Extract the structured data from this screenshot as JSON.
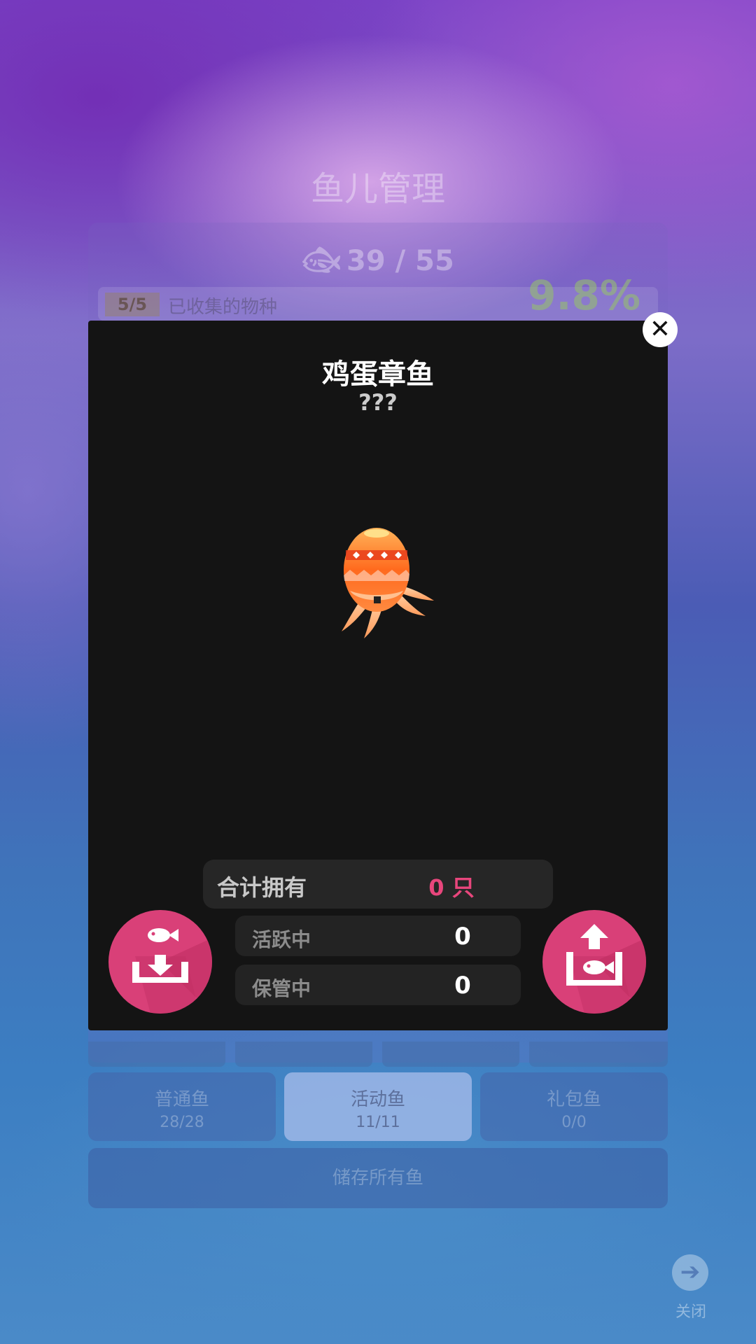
{
  "background": {
    "title": "鱼儿管理",
    "fish_count": "39 / 55",
    "species_badge": "5/5",
    "species_label": "已收集的物种",
    "percent": "9.8%",
    "tabs": [
      {
        "name": "普通鱼",
        "count": "28/28"
      },
      {
        "name": "活动鱼",
        "count": "11/11"
      },
      {
        "name": "礼包鱼",
        "count": "0/0"
      }
    ],
    "store_all": "储存所有鱼",
    "close_label": "关闭"
  },
  "modal": {
    "fish_name": "鸡蛋章鱼",
    "fish_subtitle": "???",
    "total_label": "合计拥有",
    "total_value": "0 只",
    "active_label": "活跃中",
    "active_value": "0",
    "stored_label": "保管中",
    "stored_value": "0"
  },
  "icons": {
    "close": "close-icon",
    "store_fish": "store-fish-icon",
    "release_fish": "release-fish-icon",
    "arrow_right": "arrow-right-icon"
  },
  "colors": {
    "accent_pink": "#d94078",
    "total_value": "#e8467c",
    "modal_bg": "#141414"
  }
}
